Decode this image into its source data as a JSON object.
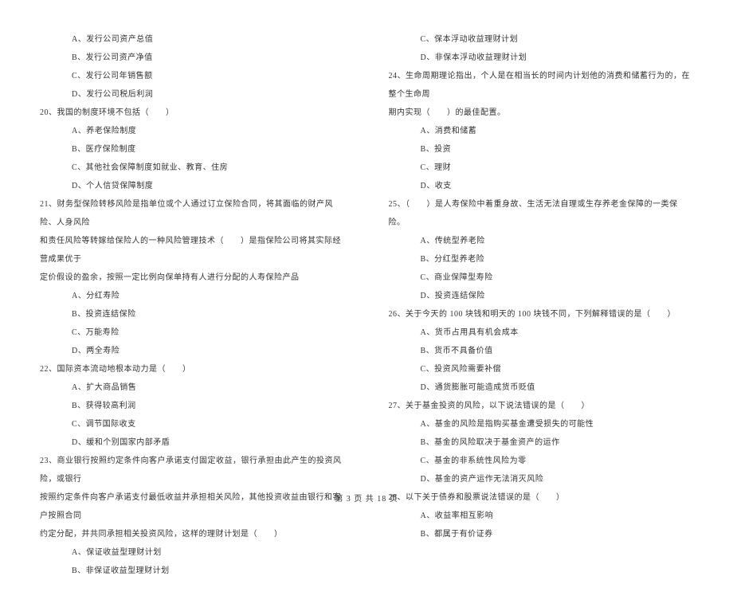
{
  "left_col": [
    {
      "cls": "option",
      "text": "A、发行公司资产总值"
    },
    {
      "cls": "option",
      "text": "B、发行公司资产净值"
    },
    {
      "cls": "option",
      "text": "C、发行公司年销售额"
    },
    {
      "cls": "option",
      "text": "D、发行公司税后利润"
    },
    {
      "cls": "question",
      "text": "20、我国的制度环境不包括（　　）"
    },
    {
      "cls": "option",
      "text": "A、养老保险制度"
    },
    {
      "cls": "option",
      "text": "B、医疗保险制度"
    },
    {
      "cls": "option",
      "text": "C、其他社会保障制度如就业、教育、住房"
    },
    {
      "cls": "option",
      "text": "D、个人信贷保障制度"
    },
    {
      "cls": "question",
      "text": "21、财务型保险转移风险是指单位或个人通过订立保险合同，将其面临的财产风险、人身风险"
    },
    {
      "cls": "question-cont",
      "text": "和责任风险等转嫁给保险人的一种风险管理技术（　　）是指保险公司将其实际经营成果优于"
    },
    {
      "cls": "question-cont",
      "text": "定价假设的盈余，按照一定比例向保单持有人进行分配的人寿保险产品"
    },
    {
      "cls": "option",
      "text": "A、分红寿险"
    },
    {
      "cls": "option",
      "text": "B、投资连结保险"
    },
    {
      "cls": "option",
      "text": "C、万能寿险"
    },
    {
      "cls": "option",
      "text": "D、两全寿险"
    },
    {
      "cls": "question",
      "text": "22、国际资本流动地根本动力是（　　）"
    },
    {
      "cls": "option",
      "text": "A、扩大商品销售"
    },
    {
      "cls": "option",
      "text": "B、获得较高利润"
    },
    {
      "cls": "option",
      "text": "C、调节国际收支"
    },
    {
      "cls": "option",
      "text": "D、缓和个别国家内部矛盾"
    },
    {
      "cls": "question",
      "text": "23、商业银行按照约定条件向客户承诺支付固定收益，银行承担由此产生的投资风险，或银行"
    },
    {
      "cls": "question-cont",
      "text": "按照约定条件向客户承诺支付最低收益并承担相关风险，其他投资收益由银行和客户按照合同"
    },
    {
      "cls": "question-cont",
      "text": "约定分配，并共同承担相关投资风险，这样的理财计划是（　　）"
    },
    {
      "cls": "option",
      "text": "A、保证收益型理财计划"
    },
    {
      "cls": "option",
      "text": "B、非保证收益型理财计划"
    }
  ],
  "right_col": [
    {
      "cls": "option",
      "text": "C、保本浮动收益理财计划"
    },
    {
      "cls": "option",
      "text": "D、非保本浮动收益理财计划"
    },
    {
      "cls": "question",
      "text": "24、生命周期理论指出，个人是在相当长的时间内计划他的消费和储蓄行为的，在整个生命周"
    },
    {
      "cls": "question-cont",
      "text": "期内实现（　　）的最佳配置。"
    },
    {
      "cls": "option",
      "text": "A、消费和储蓄"
    },
    {
      "cls": "option",
      "text": "B、投资"
    },
    {
      "cls": "option",
      "text": "C、理财"
    },
    {
      "cls": "option",
      "text": "D、收支"
    },
    {
      "cls": "question",
      "text": "25、（　　）是人寿保险中着重身故、生活无法自理或生存养老金保障的一类保险。"
    },
    {
      "cls": "option",
      "text": "A、传统型养老险"
    },
    {
      "cls": "option",
      "text": "B、分红型养老险"
    },
    {
      "cls": "option",
      "text": "C、商业保障型寿险"
    },
    {
      "cls": "option",
      "text": "D、投资连结保险"
    },
    {
      "cls": "question",
      "text": "26、关于今天的 100 块钱和明天的 100 块钱不同，下列解释错误的是（　　）"
    },
    {
      "cls": "option",
      "text": "A、货币占用具有机会成本"
    },
    {
      "cls": "option",
      "text": "B、货币不具备价值"
    },
    {
      "cls": "option",
      "text": "C、投资风险需要补偿"
    },
    {
      "cls": "option",
      "text": "D、通货膨胀可能造成货币贬值"
    },
    {
      "cls": "question",
      "text": "27、关于基金投资的风险，以下说法错误的是（　　）"
    },
    {
      "cls": "option",
      "text": "A、基金的风险是指购买基金遭受损失的可能性"
    },
    {
      "cls": "option",
      "text": "B、基金的风险取决于基金资产的运作"
    },
    {
      "cls": "option",
      "text": "C、基金的非系统性风险为零"
    },
    {
      "cls": "option",
      "text": "D、基金的资产运作无法消灭风险"
    },
    {
      "cls": "question",
      "text": "28、以下关于债券和股票说法错误的是（　　）"
    },
    {
      "cls": "option",
      "text": "A、收益率相互影响"
    },
    {
      "cls": "option",
      "text": "B、都属于有价证券"
    }
  ],
  "footer": "第 3 页 共 18 页"
}
